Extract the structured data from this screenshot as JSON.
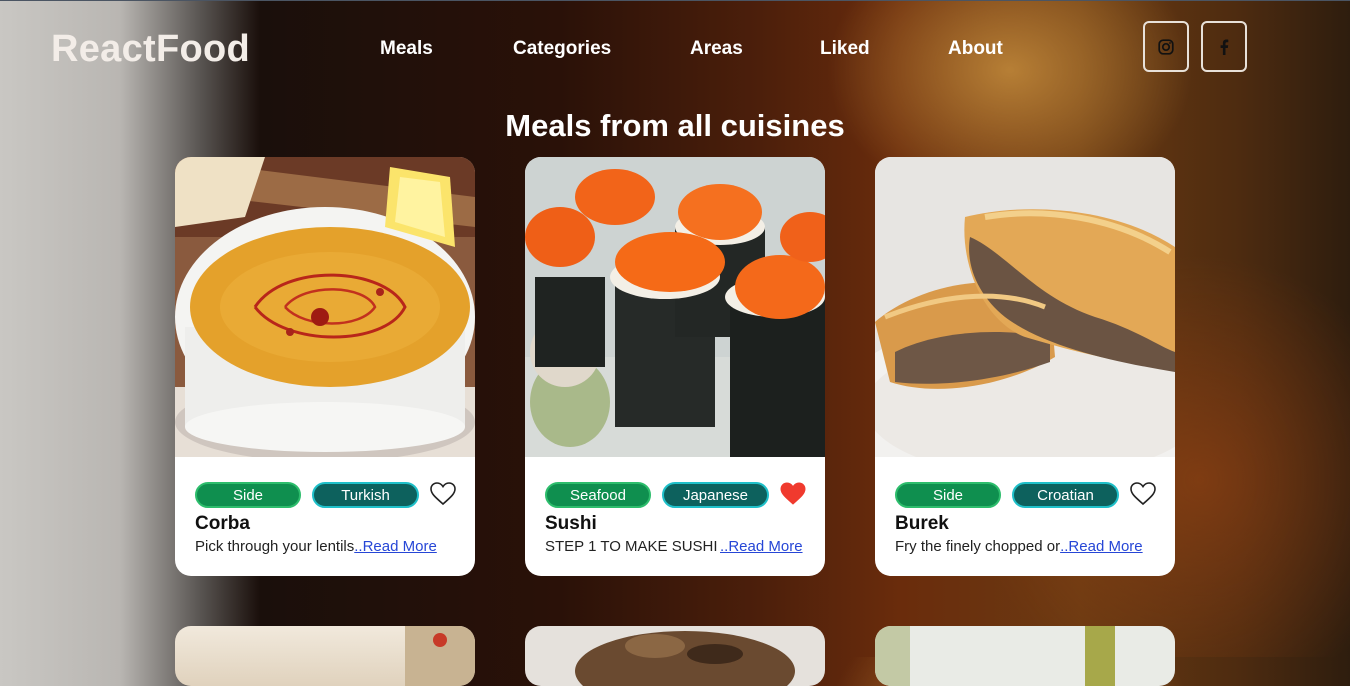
{
  "brand": {
    "logo": "ReactFood"
  },
  "nav": {
    "links": [
      "Meals",
      "Categories",
      "Areas",
      "Liked",
      "About"
    ]
  },
  "social": {
    "instagram_icon": "instagram-icon",
    "facebook_icon": "facebook-icon"
  },
  "main": {
    "title": "Meals from all cuisines",
    "read_more": "..Read More",
    "meals": [
      {
        "name": "Corba",
        "category": "Side",
        "area": "Turkish",
        "liked": false,
        "description": "Pick through your lentils"
      },
      {
        "name": "Sushi",
        "category": "Seafood",
        "area": "Japanese",
        "liked": true,
        "description": "STEP 1 TO MAKE SUSHI F"
      },
      {
        "name": "Burek",
        "category": "Side",
        "area": "Croatian",
        "liked": false,
        "description": "Fry the finely chopped or"
      }
    ]
  },
  "colors": {
    "heart_liked": "#f03a2e",
    "category_tag": "#0f8f4f",
    "area_tag": "#0d615d",
    "link": "#2646d6"
  }
}
